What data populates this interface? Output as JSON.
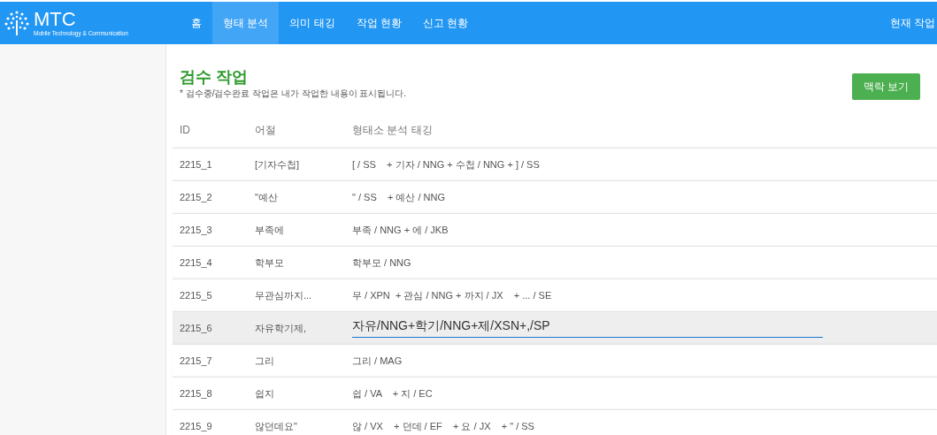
{
  "brand": {
    "title": "MTC",
    "subtitle": "Mobile Technology & Communication"
  },
  "nav": [
    {
      "label": "홈",
      "selected": false
    },
    {
      "label": "형태 분석",
      "selected": true
    },
    {
      "label": "의미 태깅",
      "selected": false
    },
    {
      "label": "작업 현황",
      "selected": false
    },
    {
      "label": "신고 현황",
      "selected": false
    }
  ],
  "nav_right": "현재 작업",
  "page": {
    "title": "검수 작업",
    "note": "* 검수중/검수완료 작업은 내가 작업한 내용이 표시됩니다.",
    "button": "맥락 보기"
  },
  "table": {
    "columns": [
      "ID",
      "어절",
      "형태소 분석 태깅"
    ],
    "rows": [
      {
        "id": "2215_1",
        "word": "[기자수첩]",
        "tagging": "[ / SS    + 기자 / NNG + 수첩 / NNG + ] / SS",
        "editing": false
      },
      {
        "id": "2215_2",
        "word": "\"예산",
        "tagging": "\" / SS    + 예산 / NNG",
        "editing": false
      },
      {
        "id": "2215_3",
        "word": "부족에",
        "tagging": "부족 / NNG + 에 / JKB",
        "editing": false
      },
      {
        "id": "2215_4",
        "word": "학부모",
        "tagging": "학부모 / NNG",
        "editing": false
      },
      {
        "id": "2215_5",
        "word": "무관심까지...",
        "tagging": "무 / XPN  + 관심 / NNG + 까지 / JX    + ... / SE",
        "editing": false
      },
      {
        "id": "2215_6",
        "word": "자유학기제,",
        "tagging": "자유/NNG+학기/NNG+제/XSN+,/SP",
        "editing": true
      },
      {
        "id": "2215_7",
        "word": "그리",
        "tagging": "그리 / MAG",
        "editing": false
      },
      {
        "id": "2215_8",
        "word": "쉽지",
        "tagging": "쉽 / VA    + 지 / EC",
        "editing": false
      },
      {
        "id": "2215_9",
        "word": "않던데요\"",
        "tagging": "않 / VX    + 던데 / EF    + 요 / JX    + \" / SS",
        "editing": false
      }
    ]
  }
}
